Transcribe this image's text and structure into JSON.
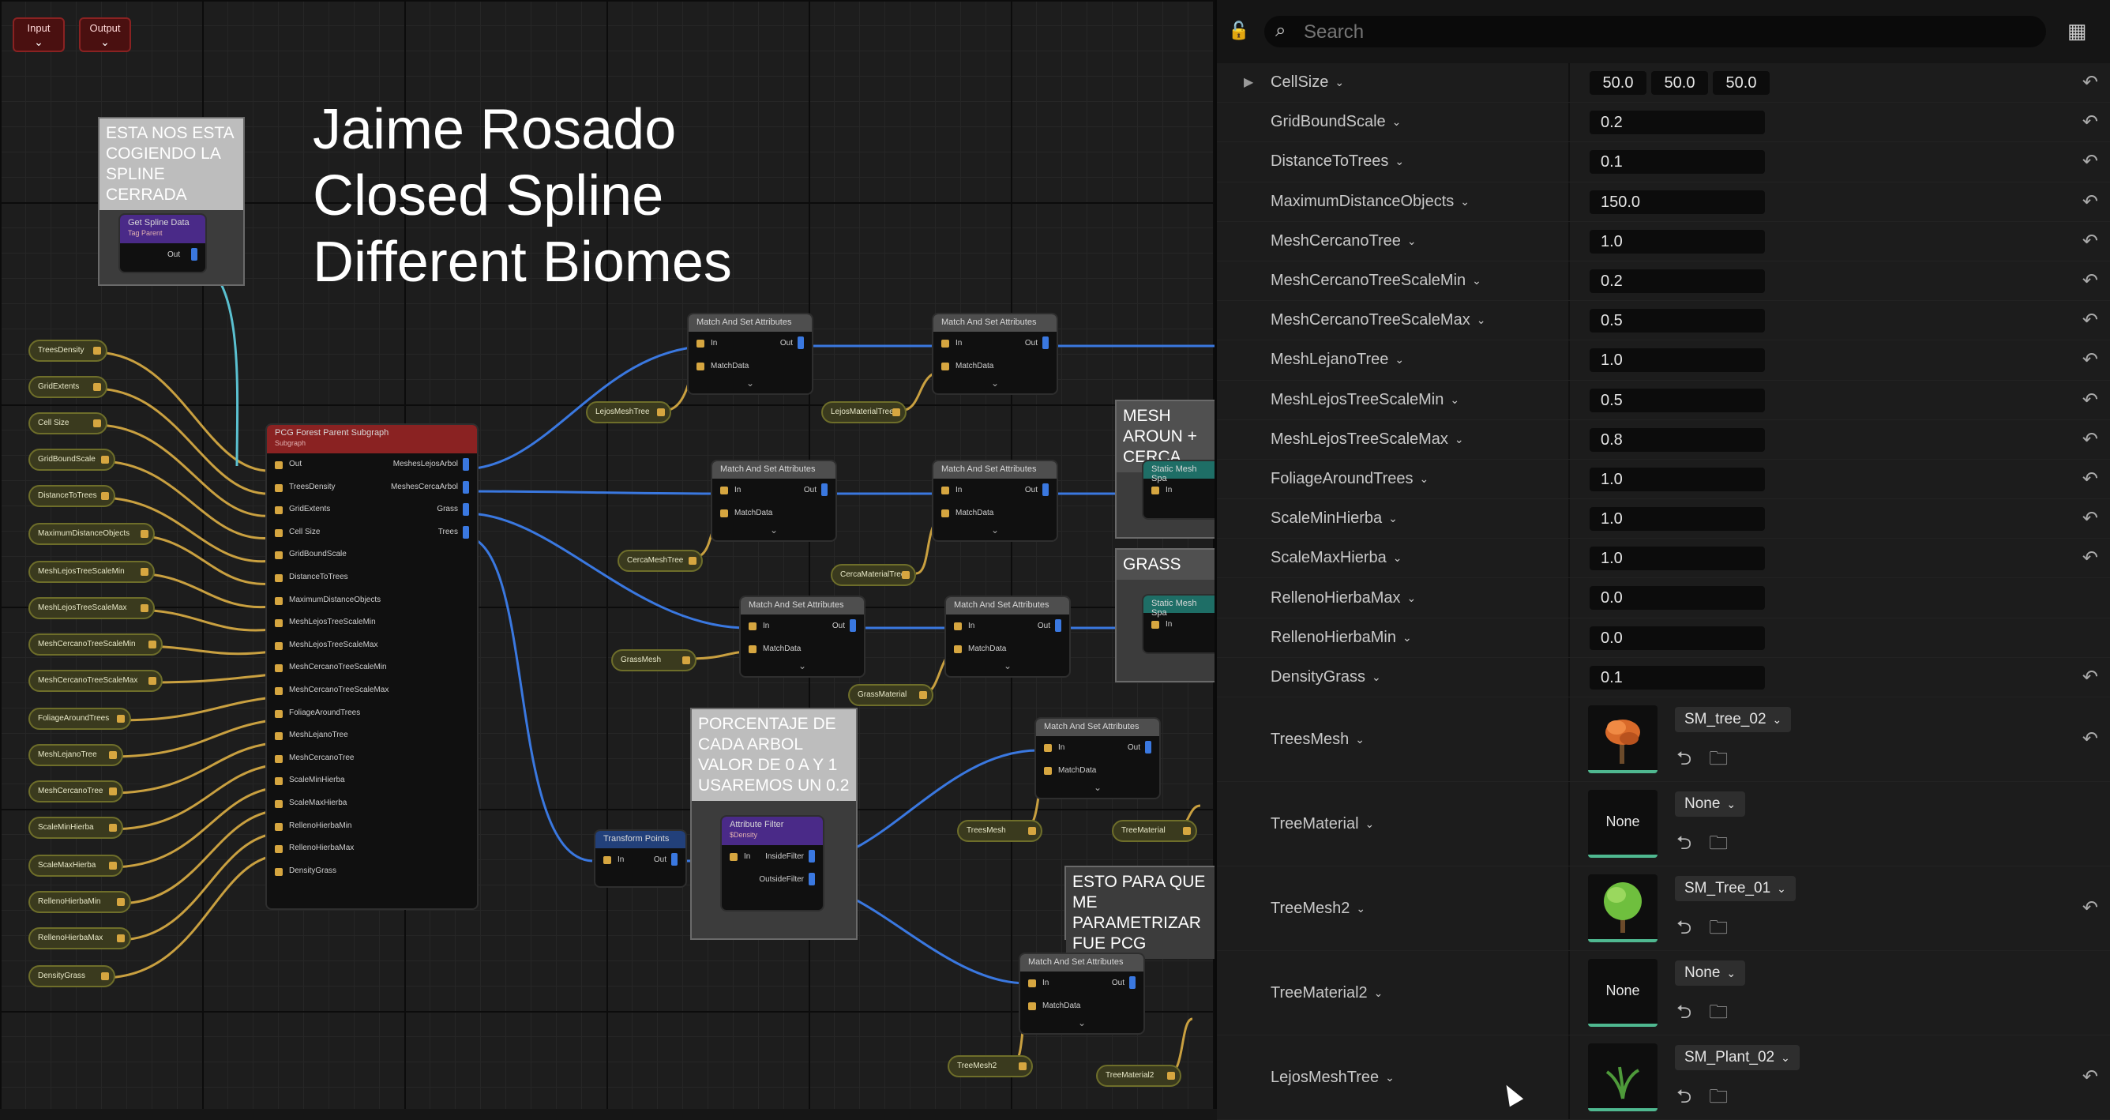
{
  "graph": {
    "input_label": "Input",
    "output_label": "Output",
    "title_lines": [
      "Jaime Rosado",
      "Closed Spline",
      "Different Biomes"
    ],
    "comments": {
      "spline": "ESTA NOS ESTA COGIENDO LA SPLINE CERRADA",
      "porcentaje": "PORCENTAJE DE CADA ARBOL VALOR DE 0 A Y 1 USAREMOS UN 0.2",
      "mesh_around": "MESH AROUN + CERCA",
      "grass": "Grass",
      "parametrizar": "ESTO PARA QUE ME PARAMETRIZAR FUE PCG"
    },
    "param_nodes": [
      "TreesDensity",
      "GridExtents",
      "Cell Size",
      "GridBoundScale",
      "DistanceToTrees",
      "MaximumDistanceObjects",
      "MeshLejosTreeScaleMin",
      "MeshLejosTreeScaleMax",
      "MeshCercanoTreeScaleMin",
      "MeshCercanoTreeScaleMax",
      "FoliageAroundTrees",
      "MeshLejanoTree",
      "MeshCercanoTree",
      "ScaleMinHierba",
      "ScaleMaxHierba",
      "RellenoHierbaMin",
      "RellenoHierbaMax",
      "DensityGrass"
    ],
    "spline_node": {
      "title": "Get Spline Data",
      "subtitle": "Tag Parent",
      "out": "Out"
    },
    "subgraph": {
      "title": "PCG Forest Parent Subgraph",
      "subtitle": "Subgraph",
      "inputs": [
        "Out",
        "TreesDensity",
        "GridExtents",
        "Cell Size",
        "GridBoundScale",
        "DistanceToTrees",
        "MaximumDistanceObjects",
        "MeshLejosTreeScaleMin",
        "MeshLejosTreeScaleMax",
        "MeshCercanoTreeScaleMin",
        "MeshCercanoTreeScaleMax",
        "FoliageAroundTrees",
        "MeshLejanoTree",
        "MeshCercanoTree",
        "ScaleMinHierba",
        "ScaleMaxHierba",
        "RellenoHierbaMin",
        "RellenoHierbaMax",
        "DensityGrass"
      ],
      "outputs": [
        "MeshesLejosArbol",
        "MeshesCercaArbol",
        "Grass",
        "Trees"
      ]
    },
    "match_title": "Match And Set Attributes",
    "in_label": "In",
    "out_label": "Out",
    "match_data": "MatchData",
    "transform": {
      "title": "Transform Points",
      "in": "In",
      "out": "Out"
    },
    "attr_filter": {
      "title": "Attribute Filter",
      "subtitle": "$Density",
      "in": "In",
      "inside": "InsideFilter",
      "outside": "OutsideFilter"
    },
    "static_mesh": "Static Mesh Spa",
    "small_params": [
      "LejosMeshTree",
      "LejosMaterialTree",
      "CercaMeshTree",
      "CercaMaterialTree",
      "GrassMesh",
      "GrassMaterial",
      "TreesMesh",
      "TreeMaterial",
      "TreeMesh2",
      "TreeMaterial2"
    ]
  },
  "panel": {
    "search_placeholder": "Search",
    "cellsize": {
      "name": "CellSize",
      "x": "50.0",
      "y": "50.0",
      "z": "50.0"
    },
    "rows": [
      {
        "name": "GridBoundScale",
        "value": "0.2"
      },
      {
        "name": "DistanceToTrees",
        "value": "0.1"
      },
      {
        "name": "MaximumDistanceObjects",
        "value": "150.0"
      },
      {
        "name": "MeshCercanoTree",
        "value": "1.0"
      },
      {
        "name": "MeshCercanoTreeScaleMin",
        "value": "0.2"
      },
      {
        "name": "MeshCercanoTreeScaleMax",
        "value": "0.5"
      },
      {
        "name": "MeshLejanoTree",
        "value": "1.0"
      },
      {
        "name": "MeshLejosTreeScaleMin",
        "value": "0.5"
      },
      {
        "name": "MeshLejosTreeScaleMax",
        "value": "0.8"
      },
      {
        "name": "FoliageAroundTrees",
        "value": "1.0"
      },
      {
        "name": "ScaleMinHierba",
        "value": "1.0"
      },
      {
        "name": "ScaleMaxHierba",
        "value": "1.0"
      },
      {
        "name": "RellenoHierbaMax",
        "value": "0.0"
      },
      {
        "name": "RellenoHierbaMin",
        "value": "0.0"
      },
      {
        "name": "DensityGrass",
        "value": "0.1"
      }
    ],
    "assets": [
      {
        "name": "TreesMesh",
        "asset": "SM_tree_02",
        "thumb": "tree-orange"
      },
      {
        "name": "TreeMaterial",
        "asset": "None",
        "thumb": "None"
      },
      {
        "name": "TreeMesh2",
        "asset": "SM_Tree_01",
        "thumb": "tree-green"
      },
      {
        "name": "TreeMaterial2",
        "asset": "None",
        "thumb": "None"
      },
      {
        "name": "LejosMeshTree",
        "asset": "SM_Plant_02",
        "thumb": "plant"
      }
    ]
  }
}
